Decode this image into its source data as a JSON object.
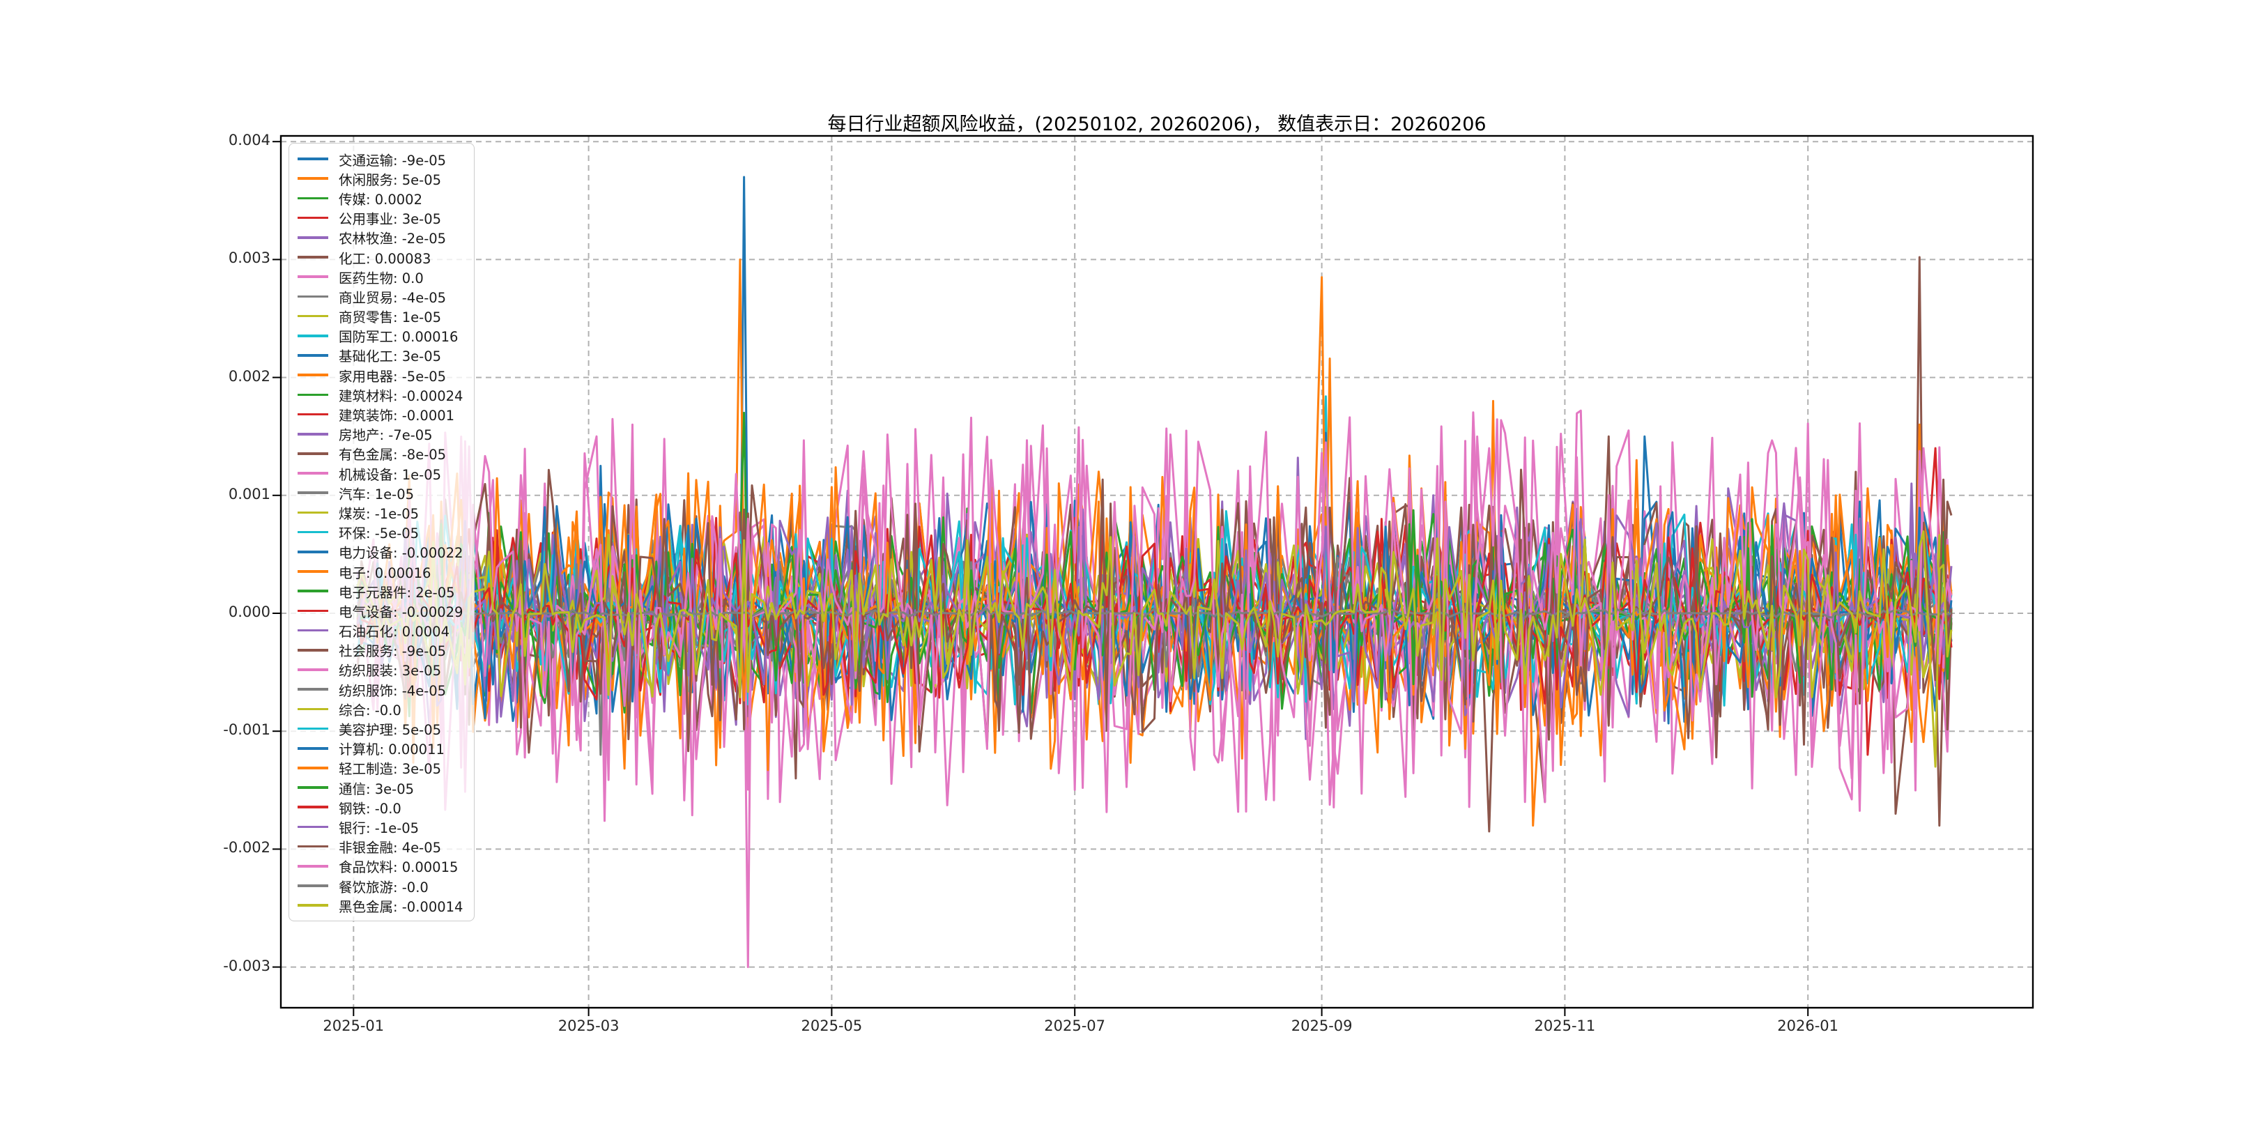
{
  "chart_data": {
    "type": "line",
    "title": "每日行业超额风险收益，(20250102, 20260206)， 数值表示日：20260206",
    "value_date": "20260206",
    "date_range": [
      "2025-01-02",
      "2026-02-06"
    ],
    "x_tick_labels": [
      "2025-01",
      "2025-03",
      "2025-05",
      "2025-07",
      "2025-09",
      "2025-11",
      "2026-01"
    ],
    "x_tick_dates": [
      "2025-01-01",
      "2025-03-01",
      "2025-05-01",
      "2025-07-01",
      "2025-09-01",
      "2025-11-01",
      "2026-01-01"
    ],
    "y_ticks": [
      0.004,
      0.003,
      0.002,
      0.001,
      0.0,
      -0.001,
      -0.002,
      -0.003
    ],
    "y_tick_labels": [
      "0.004",
      "0.003",
      "0.002",
      "0.001",
      "0.000",
      "-0.001",
      "-0.002",
      "-0.003"
    ],
    "ylim": [
      -0.00334,
      0.00404
    ],
    "grid": "dashed",
    "legend_position": "upper-left",
    "palette": [
      "#1f77b4",
      "#ff7f0e",
      "#2ca02c",
      "#d62728",
      "#9467bd",
      "#8c564b",
      "#e377c2",
      "#7f7f7f",
      "#bcbd22",
      "#17becf"
    ],
    "series": [
      {
        "name": "交通运输",
        "value": "-9e-05",
        "color": "#1f77b4"
      },
      {
        "name": "休闲服务",
        "value": "5e-05",
        "color": "#ff7f0e"
      },
      {
        "name": "传媒",
        "value": "0.0002",
        "color": "#2ca02c"
      },
      {
        "name": "公用事业",
        "value": "3e-05",
        "color": "#d62728"
      },
      {
        "name": "农林牧渔",
        "value": "-2e-05",
        "color": "#9467bd"
      },
      {
        "name": "化工",
        "value": "0.00083",
        "color": "#8c564b"
      },
      {
        "name": "医药生物",
        "value": "0.0",
        "color": "#e377c2"
      },
      {
        "name": "商业贸易",
        "value": "-4e-05",
        "color": "#7f7f7f"
      },
      {
        "name": "商贸零售",
        "value": "1e-05",
        "color": "#bcbd22"
      },
      {
        "name": "国防军工",
        "value": "0.00016",
        "color": "#17becf"
      },
      {
        "name": "基础化工",
        "value": "3e-05",
        "color": "#1f77b4"
      },
      {
        "name": "家用电器",
        "value": "-5e-05",
        "color": "#ff7f0e"
      },
      {
        "name": "建筑材料",
        "value": "-0.00024",
        "color": "#2ca02c"
      },
      {
        "name": "建筑装饰",
        "value": "-0.0001",
        "color": "#d62728"
      },
      {
        "name": "房地产",
        "value": "-7e-05",
        "color": "#9467bd"
      },
      {
        "name": "有色金属",
        "value": "-8e-05",
        "color": "#8c564b"
      },
      {
        "name": "机械设备",
        "value": "1e-05",
        "color": "#e377c2"
      },
      {
        "name": "汽车",
        "value": "1e-05",
        "color": "#7f7f7f"
      },
      {
        "name": "煤炭",
        "value": "-1e-05",
        "color": "#bcbd22"
      },
      {
        "name": "环保",
        "value": "-5e-05",
        "color": "#17becf"
      },
      {
        "name": "电力设备",
        "value": "-0.00022",
        "color": "#1f77b4"
      },
      {
        "name": "电子",
        "value": "0.00016",
        "color": "#ff7f0e"
      },
      {
        "name": "电子元器件",
        "value": "2e-05",
        "color": "#2ca02c"
      },
      {
        "name": "电气设备",
        "value": "-0.00029",
        "color": "#d62728"
      },
      {
        "name": "石油石化",
        "value": "0.0004",
        "color": "#9467bd"
      },
      {
        "name": "社会服务",
        "value": "-9e-05",
        "color": "#8c564b"
      },
      {
        "name": "纺织服装",
        "value": "3e-05",
        "color": "#e377c2"
      },
      {
        "name": "纺织服饰",
        "value": "-4e-05",
        "color": "#7f7f7f"
      },
      {
        "name": "综合",
        "value": "-0.0",
        "color": "#bcbd22"
      },
      {
        "name": "美容护理",
        "value": "5e-05",
        "color": "#17becf"
      },
      {
        "name": "计算机",
        "value": "0.00011",
        "color": "#1f77b4"
      },
      {
        "name": "轻工制造",
        "value": "3e-05",
        "color": "#ff7f0e"
      },
      {
        "name": "通信",
        "value": "3e-05",
        "color": "#2ca02c"
      },
      {
        "name": "钢铁",
        "value": "-0.0",
        "color": "#d62728"
      },
      {
        "name": "银行",
        "value": "-1e-05",
        "color": "#9467bd"
      },
      {
        "name": "非银金融",
        "value": "4e-05",
        "color": "#8c564b"
      },
      {
        "name": "食品饮料",
        "value": "0.00015",
        "color": "#e377c2"
      },
      {
        "name": "餐饮旅游",
        "value": "-0.0",
        "color": "#7f7f7f"
      },
      {
        "name": "黑色金属",
        "value": "-0.00014",
        "color": "#bcbd22"
      }
    ],
    "notable_spikes": [
      {
        "series_index": 0,
        "series": "交通运输",
        "date": "2025-03-04",
        "value": 0.00125
      },
      {
        "series_index": 0,
        "series": "交通运输",
        "date": "2025-04-09",
        "value": 0.0037
      },
      {
        "series_index": 0,
        "series": "交通运输",
        "date": "2025-11-21",
        "value": 0.0015
      },
      {
        "series_index": 1,
        "series": "休闲服务",
        "date": "2025-04-08",
        "value": 0.003
      },
      {
        "series_index": 2,
        "series": "传媒",
        "date": "2025-04-09",
        "value": 0.0017
      },
      {
        "series_index": 2,
        "series": "传媒",
        "date": "2025-09-02",
        "value": 0.0009
      },
      {
        "series_index": 3,
        "series": "公用事业",
        "date": "2026-01-16",
        "value": -0.0012
      },
      {
        "series_index": 3,
        "series": "公用事业",
        "date": "2026-02-02",
        "value": 0.0014
      },
      {
        "series_index": 4,
        "series": "农林牧渔",
        "date": "2025-02-20",
        "value": -0.0009
      },
      {
        "series_index": 5,
        "series": "化工",
        "date": "2025-04-22",
        "value": -0.0014
      },
      {
        "series_index": 5,
        "series": "化工",
        "date": "2025-10-13",
        "value": -0.00185
      },
      {
        "series_index": 5,
        "series": "化工",
        "date": "2025-10-27",
        "value": -0.0016
      },
      {
        "series_index": 5,
        "series": "化工",
        "date": "2026-01-13",
        "value": 0.0012
      },
      {
        "series_index": 5,
        "series": "化工",
        "date": "2026-01-23",
        "value": -0.0017
      },
      {
        "series_index": 5,
        "series": "化工",
        "date": "2026-01-29",
        "value": 0.00302
      },
      {
        "series_index": 5,
        "series": "化工",
        "date": "2026-02-03",
        "value": -0.0018
      },
      {
        "series_index": 6,
        "series": "医药生物",
        "date": "2025-02-18",
        "value": 0.0011
      },
      {
        "series_index": 6,
        "series": "医药生物",
        "date": "2025-03-05",
        "value": -0.00176
      },
      {
        "series_index": 6,
        "series": "医药生物",
        "date": "2025-04-10",
        "value": -0.003
      },
      {
        "series_index": 6,
        "series": "医药生物",
        "date": "2025-07-29",
        "value": 0.001
      },
      {
        "series_index": 7,
        "series": "商业贸易",
        "date": "2025-03-04",
        "value": -0.0012
      },
      {
        "series_index": 7,
        "series": "商业贸易",
        "date": "2025-05-01",
        "value": 0.00072
      },
      {
        "series_index": 7,
        "series": "商业贸易",
        "date": "2025-05-02",
        "value": 0.00074
      },
      {
        "series_index": 7,
        "series": "商业贸易",
        "date": "2025-05-05",
        "value": 0.00073
      },
      {
        "series_index": 7,
        "series": "商业贸易",
        "date": "2025-05-06",
        "value": 0.00074
      },
      {
        "series_index": 7,
        "series": "商业贸易",
        "date": "2025-05-07",
        "value": 0.0007
      },
      {
        "series_index": 7,
        "series": "商业贸易",
        "date": "2025-05-20",
        "value": 0.0006
      },
      {
        "series_index": 9,
        "series": "国防军工",
        "date": "2025-09-02",
        "value": 0.00184
      },
      {
        "series_index": 10,
        "series": "基础化工",
        "date": "2025-09-02",
        "value": 0.00153
      },
      {
        "series_index": 11,
        "series": "家用电器",
        "date": "2025-09-01",
        "value": 0.00285
      },
      {
        "series_index": 11,
        "series": "家用电器",
        "date": "2025-09-03",
        "value": 0.00216
      },
      {
        "series_index": 15,
        "series": "有色金属",
        "date": "2025-11-12",
        "value": 0.0015
      },
      {
        "series_index": 16,
        "series": "机械设备",
        "date": "2025-03-03",
        "value": 0.0015
      },
      {
        "series_index": 16,
        "series": "机械设备",
        "date": "2025-04-24",
        "value": 0.0013
      },
      {
        "series_index": 16,
        "series": "机械设备",
        "date": "2025-08-05",
        "value": -0.0012
      },
      {
        "series_index": 21,
        "series": "电力设备",
        "date": "2025-10-14",
        "value": 0.0018
      },
      {
        "series_index": 21,
        "series": "电力设备",
        "date": "2025-10-24",
        "value": -0.0018
      },
      {
        "series_index": 21,
        "series": "电力设备",
        "date": "2026-01-29",
        "value": 0.0016
      },
      {
        "series_index": 24,
        "series": "石油石化",
        "date": "2025-08-26",
        "value": 0.00132
      },
      {
        "series_index": 24,
        "series": "石油石化",
        "date": "2026-01-27",
        "value": 0.0011
      },
      {
        "series_index": 26,
        "series": "纺织服装",
        "date": "2025-06-24",
        "value": 0.00095
      },
      {
        "series_index": 26,
        "series": "纺织服装",
        "date": "2025-09-26",
        "value": 0.00105
      },
      {
        "series_index": 26,
        "series": "纺织服装",
        "date": "2025-11-17",
        "value": 0.00155
      },
      {
        "series_index": 36,
        "series": "食品饮料",
        "date": "2025-03-12",
        "value": 0.0016
      },
      {
        "series_index": 36,
        "series": "食品饮料",
        "date": "2025-06-10",
        "value": 0.0013
      },
      {
        "series_index": 36,
        "series": "食品饮料",
        "date": "2025-10-13",
        "value": 0.0014
      },
      {
        "series_index": 36,
        "series": "食品饮料",
        "date": "2025-10-22",
        "value": -0.0016
      },
      {
        "series_index": 36,
        "series": "食品饮料",
        "date": "2026-01-30",
        "value": 0.0014
      },
      {
        "series_index": 38,
        "series": "黑色金属",
        "date": "2026-02-02",
        "value": -0.0013
      }
    ]
  }
}
